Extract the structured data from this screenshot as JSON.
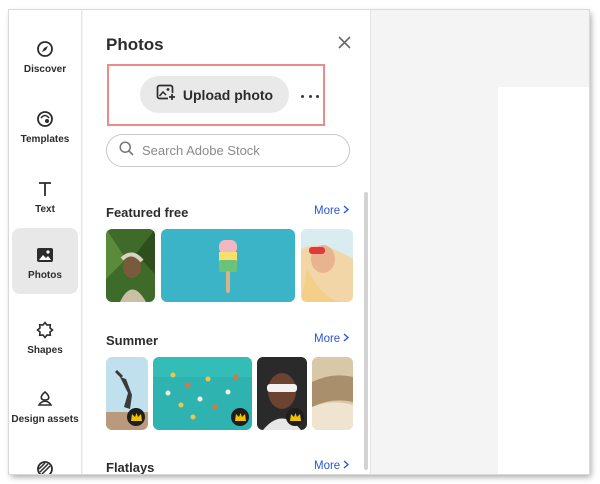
{
  "rail": {
    "items": [
      {
        "label": "Discover",
        "icon": "compass-icon"
      },
      {
        "label": "Templates",
        "icon": "templates-icon"
      },
      {
        "label": "Text",
        "icon": "text-icon"
      },
      {
        "label": "Photos",
        "icon": "photo-icon",
        "active": true
      },
      {
        "label": "Shapes",
        "icon": "shapes-icon"
      },
      {
        "label": "Design assets",
        "icon": "design-assets-icon"
      },
      {
        "label": "",
        "icon": "backgrounds-icon"
      }
    ]
  },
  "panel": {
    "title": "Photos",
    "upload_label": "Upload photo",
    "search_placeholder": "Search Adobe Stock",
    "sections": [
      {
        "title": "Featured free",
        "more": "More"
      },
      {
        "title": "Summer",
        "more": "More"
      },
      {
        "title": "Flatlays",
        "more": "More"
      }
    ]
  },
  "colors": {
    "accent_link": "#2b56d4",
    "highlight_border": "#ef8a8a",
    "active_rail_bg": "#e8e8e8"
  }
}
